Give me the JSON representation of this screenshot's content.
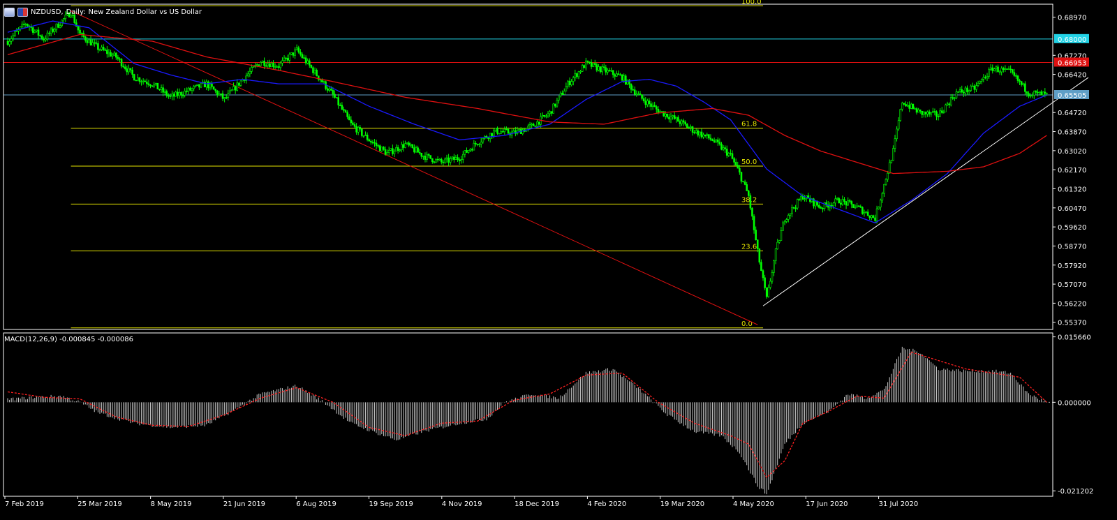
{
  "header": {
    "symbol": "NZDUSD,",
    "timeframe": "Daily:",
    "description": "New Zealand Dollar vs US Dollar"
  },
  "macd": {
    "label": "MACD(12,26,9) -0.000845 -0.000086"
  },
  "colors": {
    "background": "#000000",
    "candle": "#00ff00",
    "grid_border": "#ffffff",
    "fib": "#e6e600",
    "ma_fast": "#1a1aff",
    "ma_slow": "#e01010",
    "trend_down": "#e01010",
    "trend_up": "#ffffff",
    "hline_cyan": "#22d3e6",
    "hline_red": "#e01010",
    "hline_current": "#5f9fc7",
    "macd_hist": "#c8c8c8",
    "macd_signal": "#ff2020"
  },
  "chart_data": [
    {
      "type": "candlestick",
      "title": "NZDUSD, Daily: New Zealand Dollar vs US Dollar",
      "ylim": [
        0.5505,
        0.6955
      ],
      "price_ticks": [
        "0.68970",
        "0.67270",
        "0.66420",
        "0.64720",
        "0.63870",
        "0.63020",
        "0.62170",
        "0.61320",
        "0.60470",
        "0.59620",
        "0.58770",
        "0.57920",
        "0.57070",
        "0.56220",
        "0.55370"
      ],
      "date_ticks": [
        "7 Feb 2019",
        "25 Mar 2019",
        "8 May 2019",
        "21 Jun 2019",
        "6 Aug 2019",
        "19 Sep 2019",
        "4 Nov 2019",
        "18 Dec 2019",
        "4 Feb 2020",
        "19 Mar 2020",
        "4 May 2020",
        "17 Jun 2020",
        "31 Jul 2020"
      ],
      "price_labels": [
        {
          "text": "0.68000",
          "value": 0.68,
          "color": "#22d3e6",
          "text_color": "#ffffff"
        },
        {
          "text": "0.66953",
          "value": 0.66953,
          "color": "#e01010",
          "text_color": "#ffffff"
        },
        {
          "text": "0.65505",
          "value": 0.65505,
          "color": "#5f9fc7",
          "text_color": "#ffffff"
        }
      ],
      "fibonacci": {
        "levels": [
          {
            "label": "100.0",
            "value": 0.6948
          },
          {
            "label": "61.8",
            "value": 0.6402
          },
          {
            "label": "50.0",
            "value": 0.6233
          },
          {
            "label": "38.2",
            "value": 0.6064
          },
          {
            "label": "23.6",
            "value": 0.5855
          },
          {
            "label": "0.0",
            "value": 0.5512
          }
        ]
      },
      "series": [
        {
          "kind": "close",
          "anchors": [
            [
              0,
              0.679
            ],
            [
              10,
              0.687
            ],
            [
              20,
              0.68
            ],
            [
              30,
              0.688
            ],
            [
              35,
              0.692
            ],
            [
              40,
              0.682
            ],
            [
              50,
              0.676
            ],
            [
              60,
              0.672
            ],
            [
              70,
              0.663
            ],
            [
              80,
              0.66
            ],
            [
              90,
              0.654
            ],
            [
              100,
              0.657
            ],
            [
              110,
              0.66
            ],
            [
              120,
              0.653
            ],
            [
              130,
              0.662
            ],
            [
              140,
              0.67
            ],
            [
              150,
              0.668
            ],
            [
              160,
              0.675
            ],
            [
              170,
              0.665
            ],
            [
              180,
              0.655
            ],
            [
              190,
              0.642
            ],
            [
              200,
              0.635
            ],
            [
              210,
              0.629
            ],
            [
              220,
              0.633
            ],
            [
              230,
              0.628
            ],
            [
              240,
              0.625
            ],
            [
              250,
              0.627
            ],
            [
              260,
              0.634
            ],
            [
              270,
              0.639
            ],
            [
              280,
              0.638
            ],
            [
              290,
              0.641
            ],
            [
              300,
              0.647
            ],
            [
              310,
              0.66
            ],
            [
              320,
              0.669
            ],
            [
              330,
              0.666
            ],
            [
              340,
              0.663
            ],
            [
              350,
              0.654
            ],
            [
              360,
              0.648
            ],
            [
              370,
              0.644
            ],
            [
              380,
              0.639
            ],
            [
              390,
              0.635
            ],
            [
              400,
              0.628
            ],
            [
              405,
              0.62
            ],
            [
              410,
              0.61
            ],
            [
              415,
              0.585
            ],
            [
              420,
              0.564
            ],
            [
              425,
              0.585
            ],
            [
              430,
              0.6
            ],
            [
              440,
              0.61
            ],
            [
              450,
              0.605
            ],
            [
              460,
              0.608
            ],
            [
              470,
              0.605
            ],
            [
              480,
              0.6
            ],
            [
              485,
              0.615
            ],
            [
              490,
              0.63
            ],
            [
              495,
              0.652
            ],
            [
              505,
              0.647
            ],
            [
              515,
              0.646
            ],
            [
              525,
              0.656
            ],
            [
              535,
              0.658
            ],
            [
              545,
              0.667
            ],
            [
              555,
              0.665
            ],
            [
              565,
              0.656
            ],
            [
              575,
              0.655
            ]
          ]
        },
        {
          "kind": "ma_fast",
          "anchors": [
            [
              0,
              0.683
            ],
            [
              25,
              0.688
            ],
            [
              45,
              0.685
            ],
            [
              70,
              0.669
            ],
            [
              90,
              0.664
            ],
            [
              110,
              0.66
            ],
            [
              130,
              0.662
            ],
            [
              150,
              0.66
            ],
            [
              175,
              0.66
            ],
            [
              200,
              0.65
            ],
            [
              225,
              0.642
            ],
            [
              250,
              0.635
            ],
            [
              275,
              0.637
            ],
            [
              300,
              0.642
            ],
            [
              320,
              0.653
            ],
            [
              340,
              0.661
            ],
            [
              355,
              0.662
            ],
            [
              370,
              0.659
            ],
            [
              385,
              0.652
            ],
            [
              400,
              0.644
            ],
            [
              420,
              0.622
            ],
            [
              440,
              0.61
            ],
            [
              460,
              0.604
            ],
            [
              480,
              0.598
            ],
            [
              500,
              0.608
            ],
            [
              520,
              0.62
            ],
            [
              540,
              0.638
            ],
            [
              560,
              0.65
            ],
            [
              575,
              0.655
            ]
          ]
        },
        {
          "kind": "ma_slow",
          "anchors": [
            [
              0,
              0.673
            ],
            [
              40,
              0.682
            ],
            [
              80,
              0.679
            ],
            [
              110,
              0.672
            ],
            [
              150,
              0.666
            ],
            [
              180,
              0.661
            ],
            [
              220,
              0.654
            ],
            [
              260,
              0.649
            ],
            [
              300,
              0.643
            ],
            [
              330,
              0.642
            ],
            [
              360,
              0.647
            ],
            [
              390,
              0.649
            ],
            [
              410,
              0.646
            ],
            [
              430,
              0.637
            ],
            [
              450,
              0.63
            ],
            [
              470,
              0.625
            ],
            [
              490,
              0.62
            ],
            [
              520,
              0.621
            ],
            [
              540,
              0.623
            ],
            [
              560,
              0.629
            ],
            [
              575,
              0.637
            ]
          ]
        }
      ],
      "trendlines": [
        {
          "name": "down",
          "from": [
            35,
            0.6925
          ],
          "to": [
            415,
            0.5526
          ]
        },
        {
          "name": "up",
          "from": [
            418,
            0.561
          ],
          "to": [
            598,
            0.6628
          ]
        }
      ]
    },
    {
      "type": "histogram",
      "title": "MACD(12,26,9) -0.000845 -0.000086",
      "ylim": [
        -0.0225,
        0.0166
      ],
      "ticks": [
        "0.015660",
        "0.000000",
        "-0.021202"
      ],
      "series": [
        {
          "kind": "histogram",
          "anchors": [
            [
              0,
              0.0007
            ],
            [
              15,
              0.0012
            ],
            [
              30,
              0.0015
            ],
            [
              40,
              0.0
            ],
            [
              50,
              -0.0025
            ],
            [
              70,
              -0.005
            ],
            [
              90,
              -0.006
            ],
            [
              110,
              -0.0055
            ],
            [
              125,
              -0.002
            ],
            [
              140,
              0.002
            ],
            [
              160,
              0.004
            ],
            [
              175,
              0.0
            ],
            [
              190,
              -0.005
            ],
            [
              205,
              -0.0075
            ],
            [
              215,
              -0.009
            ],
            [
              230,
              -0.007
            ],
            [
              250,
              -0.005
            ],
            [
              265,
              -0.004
            ],
            [
              275,
              0.0
            ],
            [
              290,
              0.002
            ],
            [
              305,
              0.001
            ],
            [
              320,
              0.007
            ],
            [
              335,
              0.008
            ],
            [
              350,
              0.003
            ],
            [
              365,
              -0.003
            ],
            [
              380,
              -0.007
            ],
            [
              395,
              -0.008
            ],
            [
              405,
              -0.012
            ],
            [
              415,
              -0.02
            ],
            [
              420,
              -0.022
            ],
            [
              430,
              -0.01
            ],
            [
              440,
              -0.005
            ],
            [
              455,
              -0.002
            ],
            [
              465,
              0.002
            ],
            [
              475,
              0.001
            ],
            [
              485,
              0.003
            ],
            [
              495,
              0.013
            ],
            [
              505,
              0.012
            ],
            [
              515,
              0.008
            ],
            [
              530,
              0.0075
            ],
            [
              545,
              0.0075
            ],
            [
              555,
              0.007
            ],
            [
              565,
              0.002
            ],
            [
              575,
              0.0
            ]
          ]
        },
        {
          "kind": "signal",
          "anchors": [
            [
              0,
              0.0025
            ],
            [
              20,
              0.0012
            ],
            [
              40,
              0.0008
            ],
            [
              60,
              -0.0035
            ],
            [
              80,
              -0.0055
            ],
            [
              100,
              -0.0058
            ],
            [
              120,
              -0.003
            ],
            [
              140,
              0.001
            ],
            [
              160,
              0.0035
            ],
            [
              180,
              0.0
            ],
            [
              200,
              -0.006
            ],
            [
              220,
              -0.008
            ],
            [
              240,
              -0.005
            ],
            [
              260,
              -0.0045
            ],
            [
              280,
              0.0005
            ],
            [
              300,
              0.002
            ],
            [
              320,
              0.0065
            ],
            [
              340,
              0.007
            ],
            [
              360,
              0.0
            ],
            [
              380,
              -0.005
            ],
            [
              400,
              -0.008
            ],
            [
              410,
              -0.01
            ],
            [
              420,
              -0.018
            ],
            [
              430,
              -0.014
            ],
            [
              440,
              -0.005
            ],
            [
              455,
              -0.002
            ],
            [
              470,
              0.0015
            ],
            [
              485,
              0.001
            ],
            [
              500,
              0.012
            ],
            [
              515,
              0.01
            ],
            [
              530,
              0.008
            ],
            [
              545,
              0.007
            ],
            [
              560,
              0.006
            ],
            [
              575,
              0.0
            ]
          ]
        }
      ]
    }
  ]
}
